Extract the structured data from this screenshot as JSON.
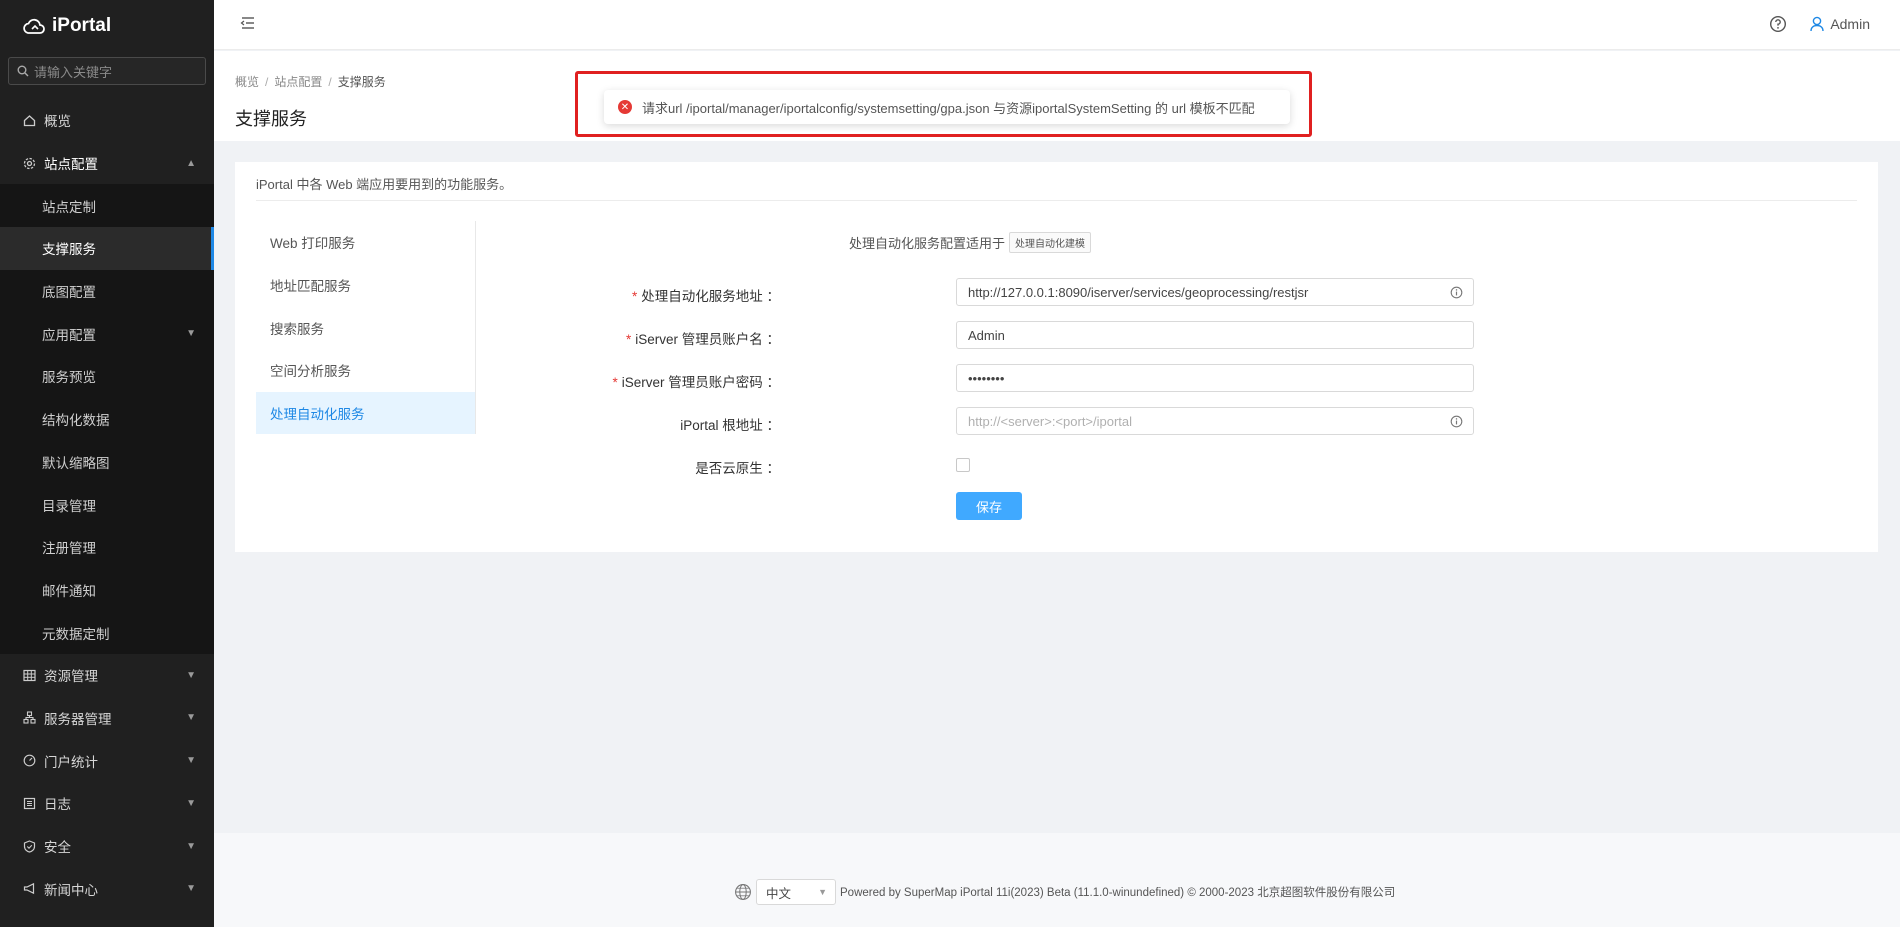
{
  "app": {
    "name": "iPortal"
  },
  "sidebar": {
    "search_placeholder": "请输入关键字",
    "items": [
      {
        "label": "概览"
      },
      {
        "label": "站点配置"
      },
      {
        "label": "资源管理"
      },
      {
        "label": "服务器管理"
      },
      {
        "label": "门户统计"
      },
      {
        "label": "日志"
      },
      {
        "label": "安全"
      },
      {
        "label": "新闻中心"
      }
    ],
    "submenu": [
      {
        "label": "站点定制"
      },
      {
        "label": "支撑服务"
      },
      {
        "label": "底图配置"
      },
      {
        "label": "应用配置"
      },
      {
        "label": "服务预览"
      },
      {
        "label": "结构化数据"
      },
      {
        "label": "默认缩略图"
      },
      {
        "label": "目录管理"
      },
      {
        "label": "注册管理"
      },
      {
        "label": "邮件通知"
      },
      {
        "label": "元数据定制"
      }
    ]
  },
  "header": {
    "user": "Admin"
  },
  "breadcrumb": {
    "items": [
      "概览",
      "站点配置",
      "支撑服务"
    ]
  },
  "page": {
    "title": "支撑服务"
  },
  "toast": {
    "message": "请求url /iportal/manager/iportalconfig/systemsetting/gpa.json 与资源iportalSystemSetting 的 url 模板不匹配"
  },
  "card": {
    "description": "iPortal 中各 Web 端应用要用到的功能服务。"
  },
  "tabs": [
    {
      "label": "Web 打印服务"
    },
    {
      "label": "地址匹配服务"
    },
    {
      "label": "搜索服务"
    },
    {
      "label": "空间分析服务"
    },
    {
      "label": "处理自动化服务"
    }
  ],
  "form": {
    "note": "处理自动化服务配置适用于",
    "note_tag": "处理自动化建模",
    "fields": [
      {
        "label": "处理自动化服务地址 ：",
        "value": "http://127.0.0.1:8090/iserver/services/geoprocessing/restjsr"
      },
      {
        "label": "iServer 管理员账户名 ：",
        "value": "Admin"
      },
      {
        "label": "iServer 管理员账户密码 ：",
        "value": "••••••••"
      },
      {
        "label": "iPortal 根地址 ：",
        "placeholder": "http://<server>:<port>/iportal"
      },
      {
        "label": "是否云原生 ："
      }
    ],
    "save_label": "保存"
  },
  "footer": {
    "language": "中文",
    "copyright": "Powered by SuperMap iPortal 11i(2023) Beta (11.1.0-winundefined) © 2000-2023 北京超图软件股份有限公司"
  }
}
